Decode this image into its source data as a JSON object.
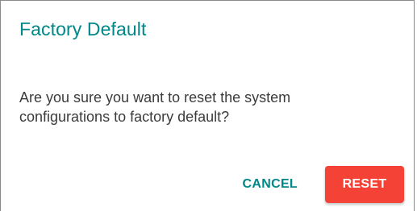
{
  "dialog": {
    "title": "Factory Default",
    "message": "Are you sure you want to reset the system configurations to factory default?",
    "cancel_label": "CANCEL",
    "reset_label": "RESET"
  },
  "colors": {
    "title": "#008787",
    "cancel_text": "#008787",
    "reset_bg": "#f44336",
    "reset_text": "#ffffff",
    "message_text": "#3b3b3b"
  }
}
